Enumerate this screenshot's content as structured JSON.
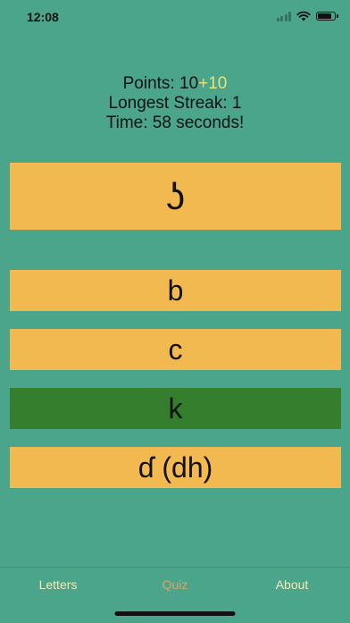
{
  "status_bar": {
    "time": "12:08",
    "signal_icon": "cellular-signal-icon",
    "wifi_icon": "wifi-icon",
    "battery_icon": "battery-icon",
    "battery_level": 0.85
  },
  "stats": {
    "points_label": "Points: ",
    "points_value": "10",
    "points_bonus": "+10",
    "streak_text": "Longest Streak: 1",
    "time_text": "Time: 58 seconds!"
  },
  "quiz": {
    "prompt": "ʖ",
    "answers": [
      {
        "label": "b",
        "state": "neutral"
      },
      {
        "label": "c",
        "state": "neutral"
      },
      {
        "label": "k",
        "state": "correct"
      },
      {
        "label": "ɗ (dh)",
        "state": "neutral"
      }
    ]
  },
  "tabs": [
    {
      "label": "Letters",
      "active": false
    },
    {
      "label": "Quiz",
      "active": true
    },
    {
      "label": "About",
      "active": false
    }
  ],
  "colors": {
    "background": "#4aa58a",
    "card": "#f2b950",
    "correct": "#357e2e",
    "bonus": "#e9e27a",
    "tab_inactive": "#f6e9b7",
    "tab_active": "#d7a66b"
  }
}
